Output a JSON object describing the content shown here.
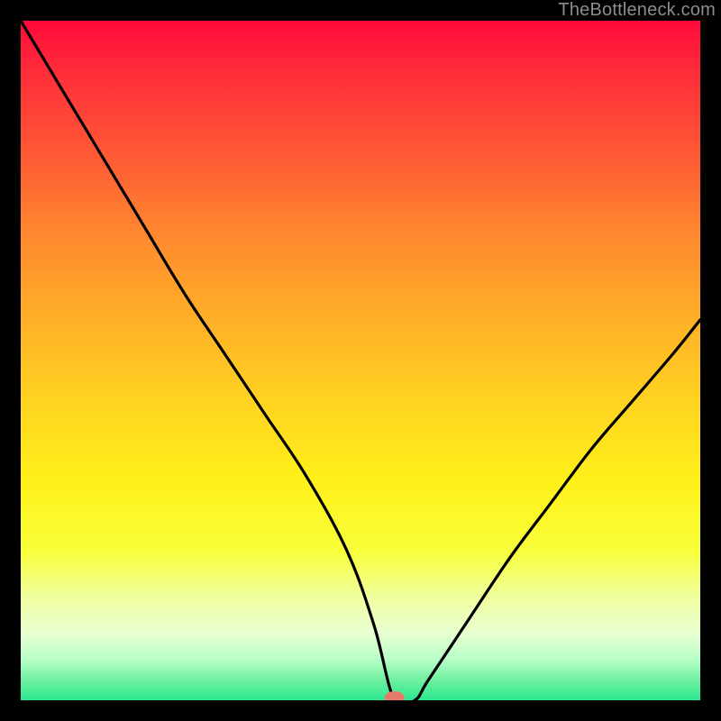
{
  "attribution": "TheBottleneck.com",
  "chart_data": {
    "type": "line",
    "title": "",
    "xlabel": "",
    "ylabel": "",
    "xlim": [
      0,
      100
    ],
    "ylim": [
      0,
      100
    ],
    "grid": false,
    "legend": false,
    "gradient": {
      "direction": "vertical",
      "top_color": "#ff0a3a",
      "bottom_color": "#2ae890",
      "meaning_top": "high bottleneck",
      "meaning_bottom": "no bottleneck"
    },
    "marker": {
      "x": 55,
      "y": 0,
      "color": "#e77a6b"
    },
    "series": [
      {
        "name": "bottleneck-curve",
        "x": [
          0,
          6,
          12,
          18,
          24,
          30,
          36,
          42,
          48,
          52,
          55,
          58,
          60,
          66,
          72,
          78,
          84,
          90,
          96,
          100
        ],
        "values": [
          100,
          90,
          80,
          70,
          60,
          51,
          42,
          33,
          22,
          11,
          0,
          0,
          3,
          12,
          21,
          29,
          37,
          44,
          51,
          56
        ]
      }
    ]
  }
}
